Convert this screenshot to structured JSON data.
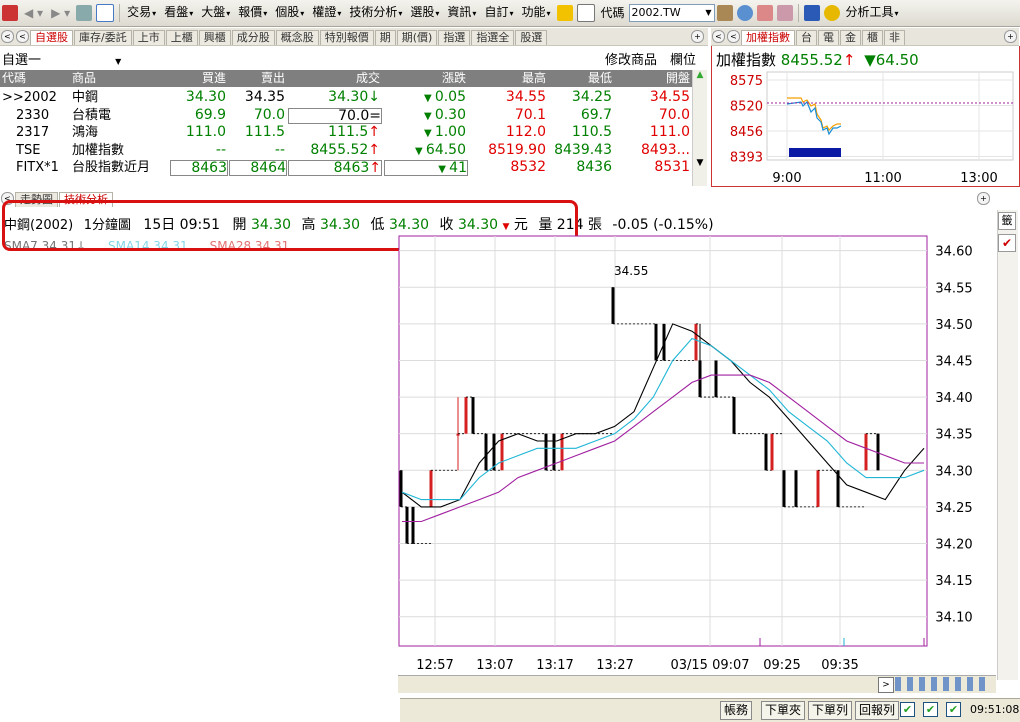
{
  "toolbar": {
    "menus": [
      "交易",
      "看盤",
      "大盤",
      "報價",
      "個股",
      "權證",
      "技術分析",
      "選股",
      "資訊",
      "自訂",
      "功能"
    ],
    "code_label": "代碼",
    "code_value": "2002.TW",
    "analysis_tools": "分析工具"
  },
  "quote_panel": {
    "tabs": [
      "自選股",
      "庫存/委託",
      "上市",
      "上櫃",
      "興櫃",
      "成分股",
      "概念股",
      "特別報價",
      "期",
      "期(價)",
      "指選",
      "指選全",
      "股選"
    ],
    "group": "自選一",
    "modify_label": "修改商品",
    "column_label": "欄位",
    "headers": [
      "代碼",
      "商品",
      "買進",
      "賣出",
      "成交",
      "漲跌",
      "最高",
      "最低",
      "開盤"
    ],
    "rows": [
      {
        "code": ">>2002",
        "name": "中鋼",
        "bid": "34.30",
        "ask": "34.35",
        "last": "34.30",
        "last_mark": "↓",
        "chg": "0.05",
        "high": "34.55",
        "low": "34.25",
        "open": "34.55"
      },
      {
        "code": "2330",
        "name": "台積電",
        "bid": "69.9",
        "ask": "70.0",
        "last": "70.0",
        "last_mark": "=",
        "chg": "0.30",
        "high": "70.1",
        "low": "69.7",
        "open": "70.0"
      },
      {
        "code": "2317",
        "name": "鴻海",
        "bid": "111.0",
        "ask": "111.5",
        "last": "111.5",
        "last_mark": "↑",
        "chg": "1.00",
        "high": "112.0",
        "low": "110.5",
        "open": "111.0"
      },
      {
        "code": "TSE",
        "name": "加權指數",
        "bid": "--",
        "ask": "--",
        "last": "8455.52",
        "last_mark": "↑",
        "chg": "64.50",
        "high": "8519.90",
        "low": "8439.43",
        "open": "8493..."
      },
      {
        "code": "FITX*1",
        "name": "台股指數近月",
        "bid": "8463",
        "ask": "8464",
        "last": "8463",
        "last_mark": "↑",
        "chg": "41",
        "high": "8532",
        "low": "8436",
        "open": "8531"
      }
    ]
  },
  "index_panel": {
    "tabs": [
      "加權指數",
      "台",
      "電",
      "金",
      "櫃",
      "非"
    ],
    "title": "加權指數",
    "value": "8455.52",
    "change": "64.50",
    "y_ticks": [
      "8575",
      "8520",
      "8456",
      "8393"
    ],
    "x_ticks": [
      "9:00",
      "11:00",
      "13:00"
    ]
  },
  "chart_panel": {
    "tabs": [
      "走勢圖",
      "技術分析"
    ],
    "stock": "中鋼(2002)",
    "period": "1分鐘圖",
    "date_time": "15日 09:51",
    "open_label": "開",
    "open": "34.30",
    "high_label": "高",
    "high": "34.30",
    "low_label": "低",
    "low": "34.30",
    "close_label": "收",
    "close": "34.30",
    "unit": "元",
    "vol_label": "量",
    "volume": "214",
    "vol_unit": "張",
    "change": "-0.05 (-0.15%)",
    "ma_legend": [
      "SMA7 34.31↓",
      "SMA14 34.31",
      "SMA28 34.31"
    ],
    "peak_label": "34.55",
    "side_label": "籤"
  },
  "chart_data": {
    "type": "candlestick",
    "y_ticks": [
      "34.60",
      "34.55",
      "34.50",
      "34.45",
      "34.40",
      "34.35",
      "34.30",
      "34.25",
      "34.20",
      "34.15",
      "34.10"
    ],
    "ylim": [
      34.06,
      34.62
    ],
    "x_ticks": [
      "12:57",
      "13:07",
      "13:17",
      "13:27",
      "03/15 09:07",
      "09:25",
      "09:35"
    ],
    "candles": [
      {
        "o": 34.3,
        "h": 34.3,
        "l": 34.25,
        "c": 34.25
      },
      {
        "o": 34.25,
        "h": 34.25,
        "l": 34.2,
        "c": 34.2
      },
      {
        "o": 34.25,
        "h": 34.25,
        "l": 34.2,
        "c": 34.2
      },
      {
        "o": 34.25,
        "h": 34.3,
        "l": 34.25,
        "c": 34.3
      },
      {
        "o": 34.35,
        "h": 34.4,
        "l": 34.3,
        "c": 34.35
      },
      {
        "o": 34.35,
        "h": 34.4,
        "l": 34.35,
        "c": 34.4
      },
      {
        "o": 34.4,
        "h": 34.4,
        "l": 34.35,
        "c": 34.35
      },
      {
        "o": 34.35,
        "h": 34.35,
        "l": 34.3,
        "c": 34.3
      },
      {
        "o": 34.35,
        "h": 34.35,
        "l": 34.3,
        "c": 34.3
      },
      {
        "o": 34.3,
        "h": 34.35,
        "l": 34.3,
        "c": 34.35
      },
      {
        "o": 34.35,
        "h": 34.35,
        "l": 34.3,
        "c": 34.3
      },
      {
        "o": 34.35,
        "h": 34.35,
        "l": 34.3,
        "c": 34.3
      },
      {
        "o": 34.3,
        "h": 34.35,
        "l": 34.3,
        "c": 34.35
      },
      {
        "o": 34.55,
        "h": 34.55,
        "l": 34.5,
        "c": 34.5
      },
      {
        "o": 34.5,
        "h": 34.5,
        "l": 34.45,
        "c": 34.45
      },
      {
        "o": 34.5,
        "h": 34.5,
        "l": 34.45,
        "c": 34.45
      },
      {
        "o": 34.45,
        "h": 34.5,
        "l": 34.45,
        "c": 34.5
      },
      {
        "o": 34.45,
        "h": 34.5,
        "l": 34.4,
        "c": 34.4
      },
      {
        "o": 34.45,
        "h": 34.45,
        "l": 34.4,
        "c": 34.4
      },
      {
        "o": 34.4,
        "h": 34.4,
        "l": 34.35,
        "c": 34.35
      },
      {
        "o": 34.35,
        "h": 34.35,
        "l": 34.3,
        "c": 34.3
      },
      {
        "o": 34.3,
        "h": 34.35,
        "l": 34.3,
        "c": 34.35
      },
      {
        "o": 34.3,
        "h": 34.3,
        "l": 34.25,
        "c": 34.25
      },
      {
        "o": 34.3,
        "h": 34.3,
        "l": 34.25,
        "c": 34.25
      },
      {
        "o": 34.25,
        "h": 34.3,
        "l": 34.25,
        "c": 34.3
      },
      {
        "o": 34.3,
        "h": 34.3,
        "l": 34.25,
        "c": 34.25
      },
      {
        "o": 34.3,
        "h": 34.35,
        "l": 34.3,
        "c": 34.35
      },
      {
        "o": 34.35,
        "h": 34.35,
        "l": 34.3,
        "c": 34.3
      }
    ],
    "sma7": [
      34.27,
      34.25,
      34.25,
      34.26,
      34.31,
      34.34,
      34.35,
      34.34,
      34.34,
      34.35,
      34.35,
      34.36,
      34.38,
      34.44,
      34.5,
      34.49,
      34.47,
      34.45,
      34.42,
      34.4,
      34.37,
      34.34,
      34.31,
      34.28,
      34.27,
      34.26,
      34.3,
      34.33
    ],
    "sma14": [
      34.27,
      34.26,
      34.26,
      34.26,
      34.29,
      34.31,
      34.32,
      34.33,
      34.33,
      34.33,
      34.34,
      34.35,
      34.37,
      34.4,
      34.45,
      34.48,
      34.47,
      34.45,
      34.43,
      34.41,
      34.38,
      34.36,
      34.34,
      34.31,
      34.29,
      34.29,
      34.29,
      34.3
    ],
    "sma28": [
      34.23,
      34.23,
      34.24,
      34.25,
      34.26,
      34.27,
      34.29,
      34.3,
      34.31,
      34.32,
      34.33,
      34.34,
      34.36,
      34.38,
      34.4,
      34.42,
      34.43,
      34.43,
      34.43,
      34.42,
      34.4,
      34.38,
      34.36,
      34.34,
      34.33,
      34.32,
      34.31,
      34.31
    ],
    "colors": {
      "up": "#d42020",
      "down": "#000000",
      "sma7": "#000000",
      "sma14": "#1fb6d6",
      "sma28": "#a020a0"
    }
  },
  "status_bar": {
    "buttons": [
      "帳務",
      "下單夾",
      "下單列",
      "回報列"
    ],
    "time": "09:51:08"
  },
  "colors": {
    "accent_red": "#d81010",
    "up": "#e00000",
    "down": "#008000",
    "header_gray": "#7f7f7f"
  }
}
